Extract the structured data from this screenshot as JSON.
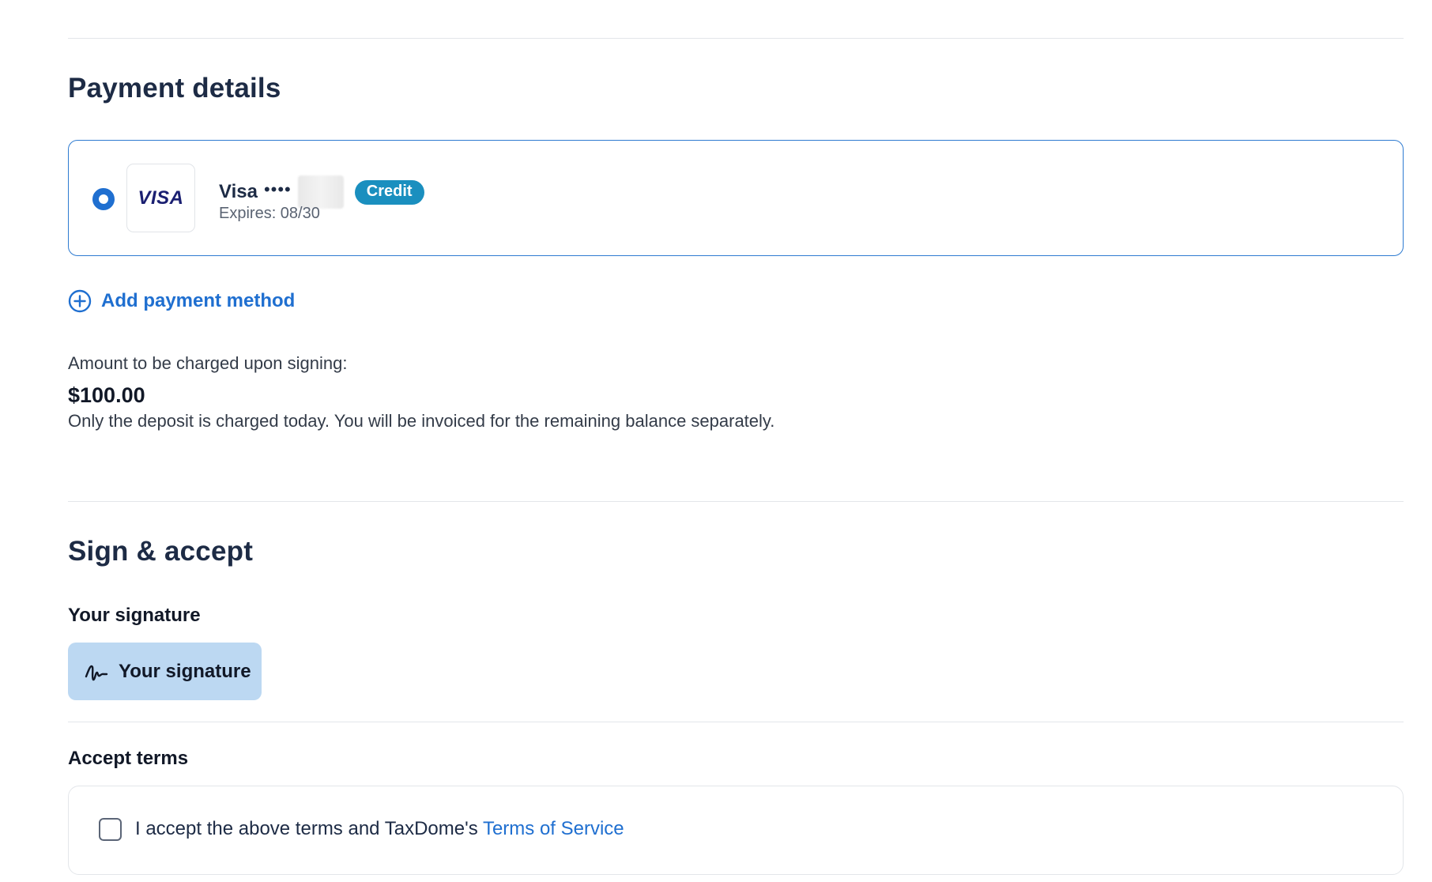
{
  "payment": {
    "title": "Payment details",
    "card": {
      "logo": "VISA",
      "brand": "Visa",
      "dots": "••••",
      "badge": "Credit",
      "expires": "Expires: 08/30",
      "selected": true
    },
    "add_method_label": "Add payment method",
    "charge_label": "Amount to be charged upon signing:",
    "charge_amount": "$100.00",
    "charge_note": "Only the deposit is charged today. You will be invoiced for the remaining balance separately."
  },
  "sign": {
    "title": "Sign & accept",
    "signature_heading": "Your signature",
    "signature_button_label": "Your signature",
    "terms_heading": "Accept terms",
    "terms_text": "I accept the above terms and TaxDome's ",
    "terms_link": "Terms of Service",
    "terms_checked": false
  },
  "colors": {
    "accent": "#1f6fd0",
    "badge": "#1a8fbf",
    "signature_button_bg": "#bcd8f2"
  },
  "icons": {
    "add": "plus-circle-icon",
    "signature": "signature-icon"
  }
}
